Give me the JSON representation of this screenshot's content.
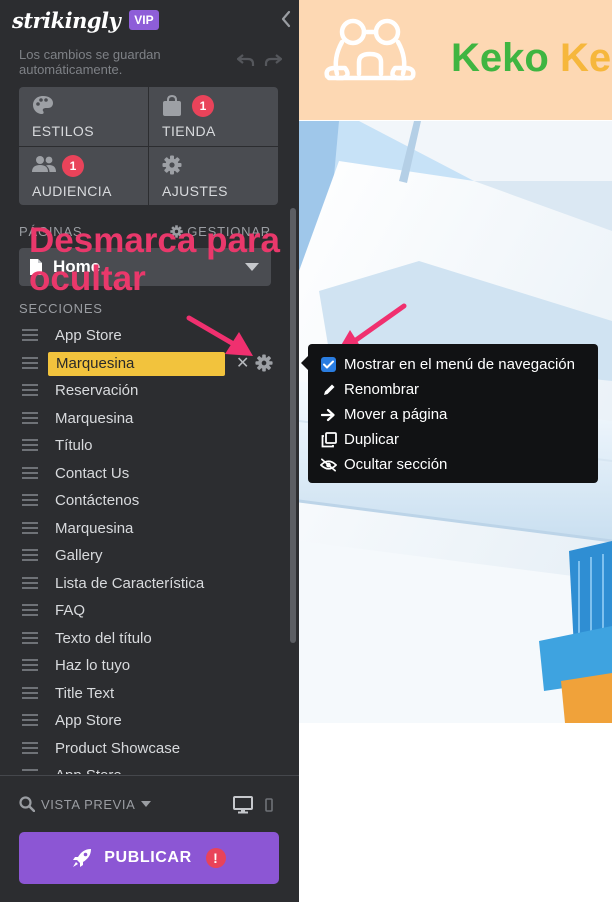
{
  "brand": {
    "name": "strikingly",
    "badge": "VIP"
  },
  "autosave": "Los cambios se guardan automáticamente.",
  "tiles": [
    {
      "id": "estilos",
      "label": "ESTILOS",
      "icon": "palette-icon"
    },
    {
      "id": "tienda",
      "label": "TIENDA",
      "icon": "shopping-bag-icon",
      "badge": "1"
    },
    {
      "id": "audiencia",
      "label": "AUDIENCIA",
      "icon": "people-icon",
      "badge": "1"
    },
    {
      "id": "ajustes",
      "label": "AJUSTES",
      "icon": "gear-icon"
    }
  ],
  "pages": {
    "heading": "PÁGINAS",
    "manage_label": "GESTIONAR",
    "current": "Home"
  },
  "sections": {
    "heading": "SECCIONES",
    "active_index": 1,
    "items": [
      "App Store",
      "Marquesina",
      "Reservación",
      "Marquesina",
      "Título",
      "Contact Us",
      "Contáctenos",
      "Marquesina",
      "Gallery",
      "Lista de Característica",
      "FAQ",
      "Texto del título",
      "Haz lo tuyo",
      "Title Text",
      "App Store",
      "Product Showcase",
      "App Store"
    ]
  },
  "preview_label": "VISTA PREVIA",
  "publish_label": "PUBLICAR",
  "publish_alert": "!",
  "site": {
    "title_a": "Keko",
    "title_b": "Ke"
  },
  "callout": {
    "line1": "Desmarca para",
    "line2": "ocultar"
  },
  "menu": {
    "items": [
      {
        "label": "Mostrar en el menú de navegación",
        "icon": "checkbox-checked-icon",
        "checked": true
      },
      {
        "label": "Renombrar",
        "icon": "pencil-icon"
      },
      {
        "label": "Mover a página",
        "icon": "arrow-right-icon"
      },
      {
        "label": "Duplicar",
        "icon": "duplicate-icon"
      },
      {
        "label": "Ocultar sección",
        "icon": "eye-slash-icon"
      }
    ]
  },
  "colors": {
    "sidebar": "#2c2d30",
    "tile": "#4a4c51",
    "accent_purple": "#8c56d4",
    "badge_red": "#e9435a",
    "highlight_yellow": "#f2c33d",
    "callout_pink": "#e9386b",
    "site_header": "#fdd8b3",
    "site_green": "#3fb541",
    "site_yellow": "#f6b73c"
  }
}
